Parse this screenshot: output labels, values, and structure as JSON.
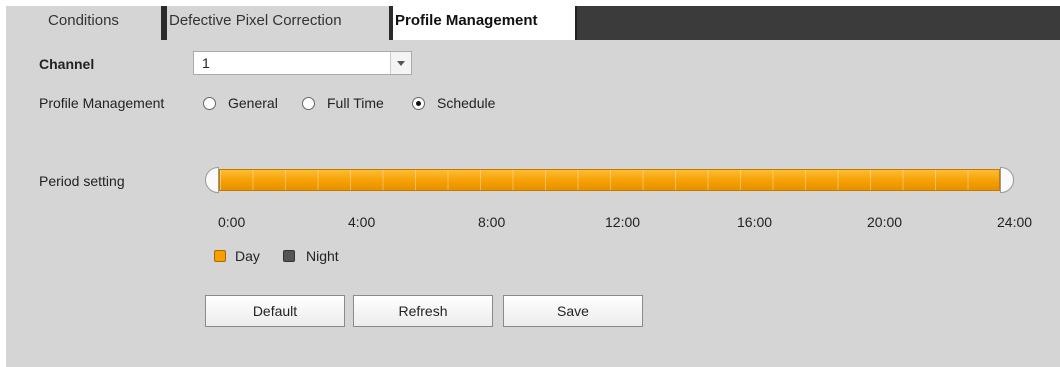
{
  "tabs": {
    "conditions": "Conditions",
    "defective": "Defective Pixel Correction",
    "profile": "Profile Management"
  },
  "channel": {
    "label": "Channel",
    "value": "1"
  },
  "profile_management": {
    "label": "Profile Management",
    "options": [
      "General",
      "Full Time",
      "Schedule"
    ],
    "selected": "Schedule"
  },
  "period": {
    "label": "Period setting",
    "ticks": [
      "0:00",
      "4:00",
      "8:00",
      "12:00",
      "16:00",
      "20:00",
      "24:00"
    ],
    "day_start_hour": 0,
    "day_end_hour": 24
  },
  "legend": {
    "day": "Day",
    "night": "Night",
    "day_color": "#f5a000",
    "night_color": "#555555"
  },
  "buttons": {
    "default": "Default",
    "refresh": "Refresh",
    "save": "Save"
  }
}
